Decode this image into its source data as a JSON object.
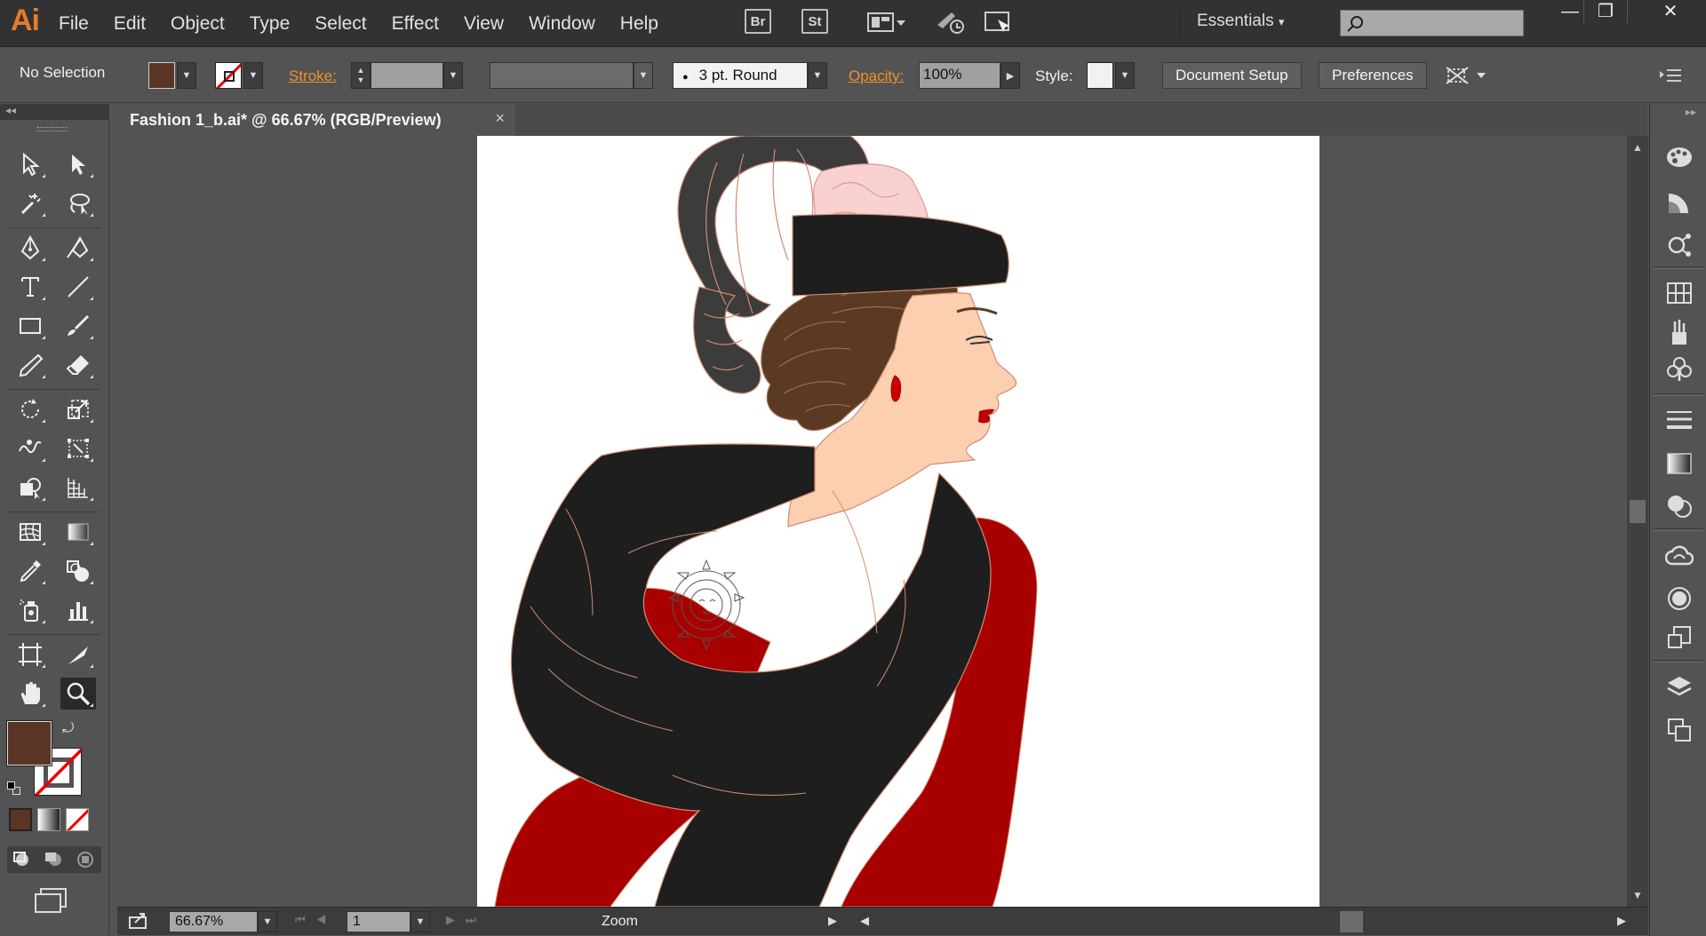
{
  "app": {
    "logo": "Ai"
  },
  "menu": [
    "File",
    "Edit",
    "Object",
    "Type",
    "Select",
    "Effect",
    "View",
    "Window",
    "Help"
  ],
  "bridge_buttons": {
    "br": "Br",
    "st": "St"
  },
  "workspace": {
    "label": "Essentials",
    "dropdown": "▾"
  },
  "window_controls": {
    "minimize": "—",
    "maximize": "❐",
    "close": "✕"
  },
  "control_bar": {
    "selection_status": "No Selection",
    "fill_color": "#5a3526",
    "stroke_label": "Stroke:",
    "brush_stroke": "3 pt. Round",
    "opacity_label": "Opacity:",
    "opacity_value": "100%",
    "style_label": "Style:",
    "document_setup": "Document Setup",
    "preferences": "Preferences"
  },
  "document_tab": {
    "title": "Fashion 1_b.ai* @ 66.67% (RGB/Preview)",
    "close": "×"
  },
  "status_bar": {
    "zoom": "66.67%",
    "artboard_number": "1",
    "current_tool": "Zoom"
  },
  "colors": {
    "fill": "#5a3526",
    "accent_orange": "#ef8f2d",
    "red_dress": "#a80000",
    "black_shawl": "#1e1e1e",
    "skin": "#fbcfb0",
    "hair": "#5a3a22"
  }
}
